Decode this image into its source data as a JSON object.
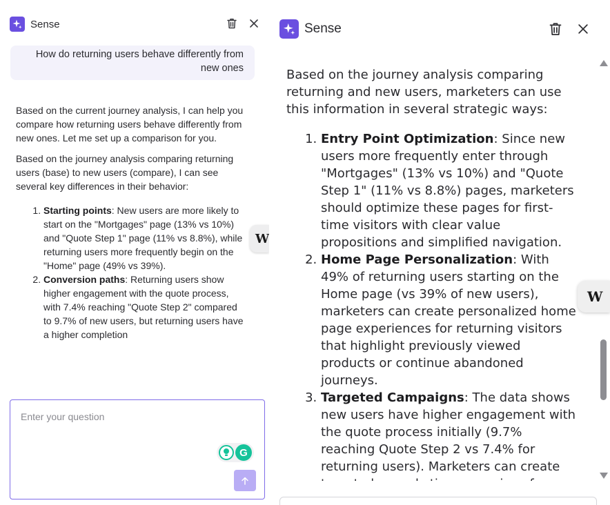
{
  "colors": {
    "brand": "#6a4fe0",
    "send_disabled": "#b9adf5",
    "bubble": "#f3f2fb",
    "grammarly": "#15c39a"
  },
  "left": {
    "brand": "Sense",
    "user_message": "How do returning users behave differently from new ones",
    "answer": {
      "p1": "Based on the current journey analysis, I can help you compare how returning users behave differently from new ones. Let me set up a comparison for you.",
      "p2": "Based on the journey analysis comparing returning users (base) to new users (compare), I can see several key differences in their behavior:",
      "items": [
        {
          "title": "Starting points",
          "text": ": New users are more likely to start on the \"Mortgages\" page (13% vs 10%) and \"Quote Step 1\" page (11% vs 8.8%), while returning users more frequently begin on the \"Home\" page (49% vs 39%)."
        },
        {
          "title": "Conversion paths",
          "text": ": Returning users show higher engagement with the quote process, with 7.4% reaching \"Quote Step 2\" compared to 9.7% of new users, but returning users have a higher completion"
        }
      ]
    },
    "input_placeholder": "Enter your question",
    "grammarly_label": "G",
    "w_tab": "W"
  },
  "right": {
    "brand": "Sense",
    "intro": "Based on the journey analysis comparing returning and new users, marketers can use this information in several strategic ways:",
    "items": [
      {
        "title": "Entry Point Optimization",
        "text": ": Since new users more frequently enter through \"Mortgages\" (13% vs 10%) and \"Quote Step 1\" (11% vs 8.8%) pages, marketers should optimize these pages for first-time visitors with clear value propositions and simplified navigation."
      },
      {
        "title": "Home Page Personalization",
        "text": ": With 49% of returning users starting on the Home page (vs 39% of new users), marketers can create personalized home page experiences for returning visitors that highlight previously viewed products or continue abandoned journeys."
      },
      {
        "title": "Targeted Campaigns",
        "text": ": The data shows new users have higher engagement with the quote process initially (9.7% reaching Quote Step 2 vs 7.4% for returning users). Marketers can create targeted remarketing campaigns for new users who start but don't complete the quote"
      }
    ],
    "w_tab": "W"
  }
}
